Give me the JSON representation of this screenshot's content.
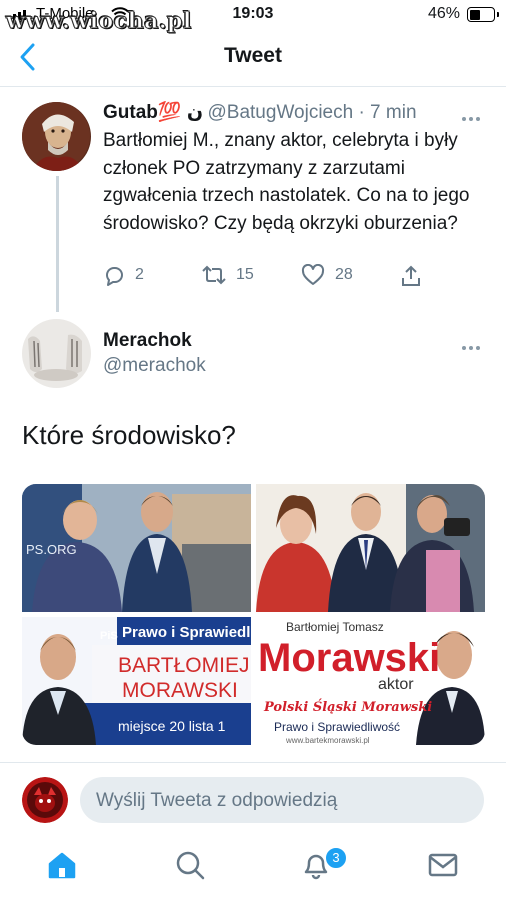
{
  "status": {
    "carrier": "T-Mobile",
    "watermark": "www.wiocha.pl",
    "time": "19:03",
    "battery_pct": "46%",
    "battery_level": 0.46
  },
  "nav": {
    "title": "Tweet",
    "back_icon": "chevron-left-icon"
  },
  "tweet1": {
    "name": "Gutab💯 ن",
    "handle": "@BatugWojciech · 7 min",
    "text": "Bartłomiej M., znany aktor, celebryta i były członek PO zatrzymany z zarzutami zgwałcenia trzech nastolatek. Co na to jego środowisko? Czy będą okrzyki oburzenia?",
    "replies": "2",
    "retweets": "15",
    "likes": "28"
  },
  "tweet2": {
    "name": "Merachok",
    "handle": "@merachok",
    "text": "Które środowisko?",
    "photos": {
      "p4_line1": "Bartłomiej Tomasz",
      "p4_big": "Morawski",
      "p4_aktor": "aktor",
      "p4_script": "Polski Śląski Morawski",
      "p4_party": "Prawo i Sprawiedliwość",
      "p4_url": "www.bartekmorawski.pl",
      "p3_party": "Prawo i Sprawiedliwość",
      "p3_logo": "PiS",
      "p3_name1": "BARTŁOMIEJ",
      "p3_name2": "MORAWSKI",
      "p3_place": "miejsce 20 lista 1",
      "p1_sign": "PS.ORG"
    }
  },
  "reply": {
    "placeholder": "Wyślij Tweeta z odpowiedzią"
  },
  "tabbar": {
    "notifications_badge": "3"
  },
  "colors": {
    "accent": "#1da1f2",
    "text": "#14171a",
    "muted": "#657786"
  }
}
